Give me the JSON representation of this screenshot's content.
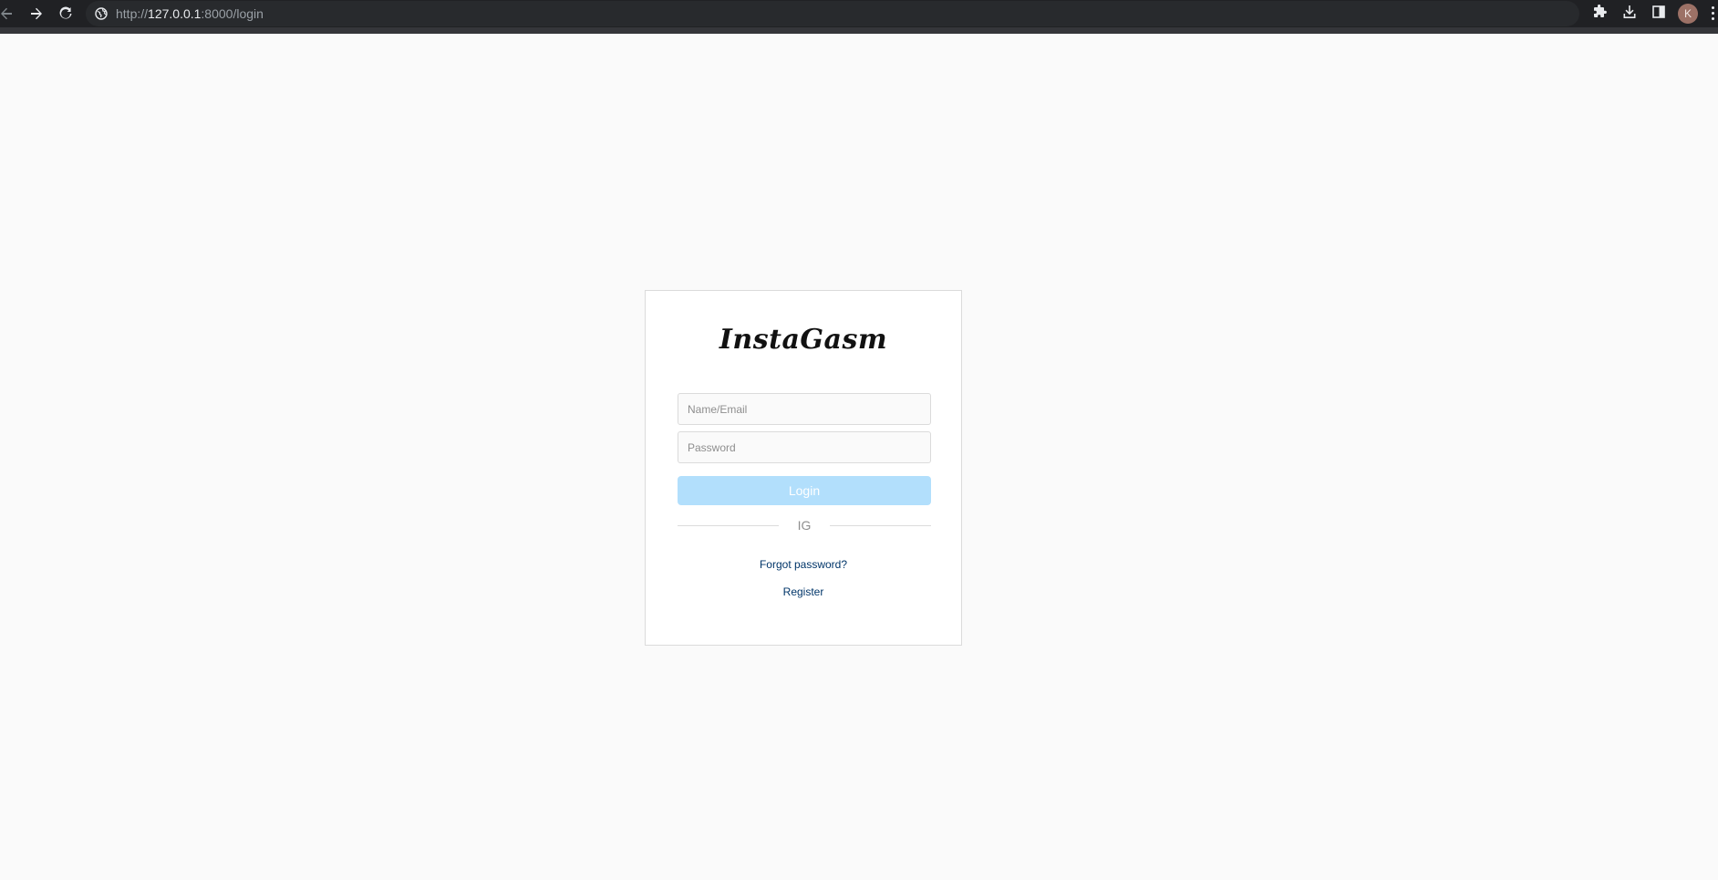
{
  "browser": {
    "url_scheme": "http://",
    "url_host": "127.0.0.1",
    "url_rest": ":8000/login",
    "profile_initial": "K",
    "icons": {
      "back": "arrow-left-icon",
      "forward": "arrow-right-icon",
      "reload": "reload-icon",
      "site_info": "globe-icon",
      "extensions": "puzzle-icon",
      "downloads": "download-icon",
      "side_panel": "side-panel-icon",
      "menu": "kebab-menu-icon"
    }
  },
  "login": {
    "brand": "InstaGasm",
    "username_placeholder": "Name/Email",
    "password_placeholder": "Password",
    "login_label": "Login",
    "divider_text": "IG",
    "forgot_label": "Forgot password?",
    "register_label": "Register"
  },
  "colors": {
    "page_background": "#fafafa",
    "login_button": "#b2dffc",
    "link": "#003569"
  }
}
